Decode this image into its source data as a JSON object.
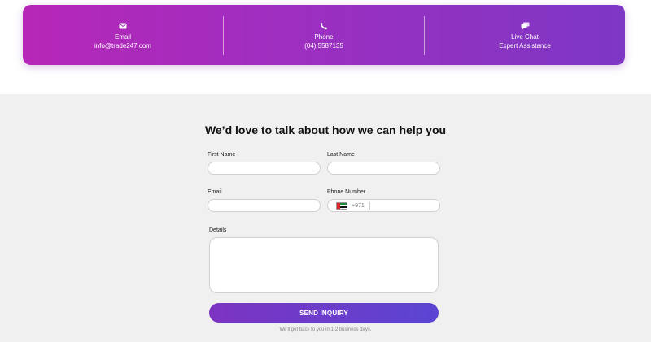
{
  "contact": {
    "email": {
      "title": "Email",
      "value": "info@trade247.com",
      "icon": "envelope-icon"
    },
    "phone": {
      "title": "Phone",
      "value": "(04) 5587135",
      "icon": "phone-icon"
    },
    "chat": {
      "title": "Live Chat",
      "value": "Expert Assistance",
      "icon": "chat-bubbles-icon"
    },
    "gradient": [
      "#b627b7",
      "#7e37c4"
    ]
  },
  "form": {
    "heading": "We’d love to talk about how we can help you",
    "first_name_label": "First Name",
    "last_name_label": "Last Name",
    "email_label": "Email",
    "phone_label": "Phone Number",
    "phone_code": "+971",
    "phone_flag": "uae-flag-icon",
    "details_label": "Details",
    "submit_label": "SEND INQUIRY",
    "note": "We'll get back to you in 1-2 business days.",
    "button_colors": [
      "#7d33c2",
      "#5b45d3"
    ]
  }
}
